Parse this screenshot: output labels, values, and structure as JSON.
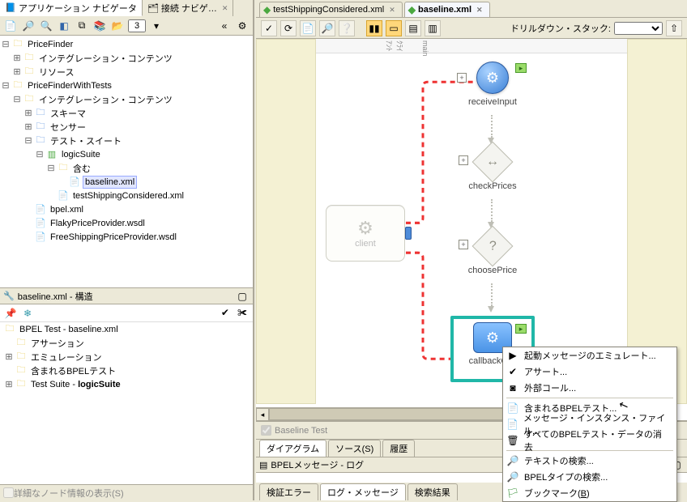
{
  "nav": {
    "tab_app": "アプリケーション ナビゲータ",
    "tab_conn": "接続 ナビゲ…"
  },
  "toolbar_left": {
    "filter_value": "3"
  },
  "tree": {
    "pf": "PriceFinder",
    "pf_int": "インテグレーション・コンテンツ",
    "pf_res": "リソース",
    "pft": "PriceFinderWithTests",
    "pft_int": "インテグレーション・コンテンツ",
    "schema": "スキーマ",
    "sensor": "センサー",
    "testsuite": "テスト・スイート",
    "logicsuite": "logicSuite",
    "include": "含む",
    "baseline": "baseline.xml",
    "testship": "testShippingConsidered.xml",
    "bpel": "bpel.xml",
    "flaky": "FlakyPriceProvider.wsdl",
    "freeship": "FreeShippingPriceProvider.wsdl"
  },
  "structure": {
    "title": "baseline.xml - 構造",
    "root": "BPEL Test - baseline.xml",
    "assertion": "アサーション",
    "emulation": "エミュレーション",
    "included": "含まれるBPELテスト",
    "suite_pre": "Test Suite - ",
    "suite_bold": "logicSuite",
    "footer": "詳細なノード情報の表示(S)"
  },
  "editor": {
    "tab_ship": "testShippingConsidered.xml",
    "tab_baseline": "baseline.xml",
    "drill_label": "ドリルダウン・スタック:",
    "ruler_left": "ｸﾗｲｱﾝﾄ",
    "ruler_main": "main"
  },
  "flow": {
    "client": "client",
    "receive": "receiveInput",
    "check": "checkPrices",
    "choose": "choosePrice",
    "callback": "callbackClie"
  },
  "bottom": {
    "baseline_chk": "Baseline Test",
    "tab_diagram": "ダイアグラム",
    "tab_source": "ソース(S)",
    "tab_history": "履歴",
    "log_title": "BPELメッセージ - ログ",
    "tab_verr": "検証エラー",
    "tab_logmsg": "ログ・メッセージ",
    "tab_search": "検索結果"
  },
  "ctx": {
    "emu": "起動メッセージのエミュレート...",
    "assert": "アサート...",
    "ext": "外部コール...",
    "incl": "含まれるBPELテスト...",
    "msgfile": "メッセージ・インスタンス・ファイル...",
    "clear": "すべてのBPELテスト・データの消去",
    "txt": "テキストの検索...",
    "type": "BPELタイプの検索...",
    "bkm_pre": "ブックマーク(",
    "bkm_u": "B",
    "bkm_post": ")"
  }
}
